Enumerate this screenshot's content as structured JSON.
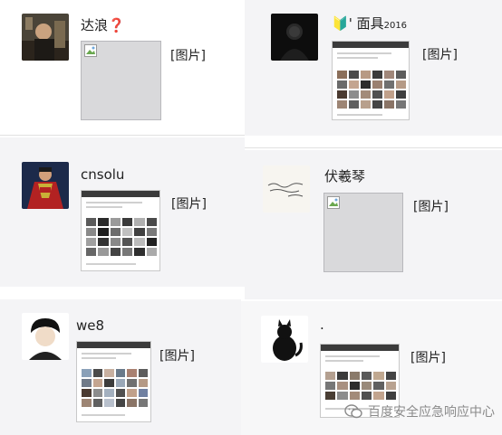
{
  "posts": [
    {
      "name": "达浪",
      "name_suffix": "❓",
      "image_label": "[图片]"
    },
    {
      "name_prefix": "🔰",
      "name": "' 面具",
      "name_small": "2016",
      "image_label": "[图片]"
    },
    {
      "name": "cnsolu",
      "image_label": "[图片]"
    },
    {
      "name": "伏羲琴",
      "image_label": "[图片]"
    },
    {
      "name": "we8",
      "image_label": "[图片]"
    },
    {
      "name": ".",
      "image_label": "[图片]"
    }
  ],
  "watermark": {
    "text": "百度安全应急响应中心",
    "icon": "wechat-icon"
  },
  "colors": {
    "card_bg": "#f4f4f6",
    "watermark": "#8a8a8a",
    "question_mark": "#c0392b"
  }
}
